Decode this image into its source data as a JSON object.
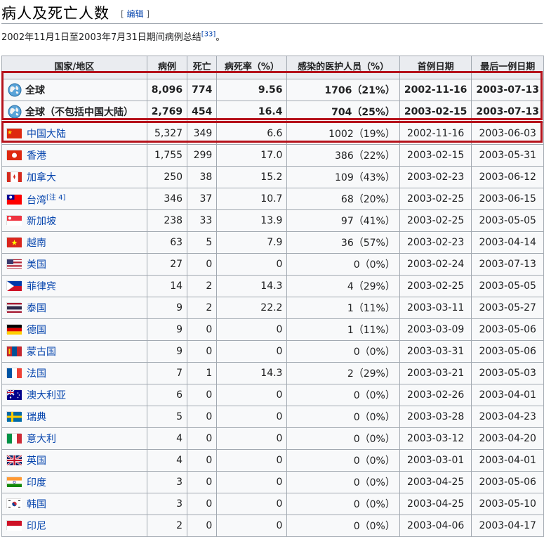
{
  "heading": {
    "title": "病人及死亡人数",
    "edit_open": "[ ",
    "edit_label": "编辑",
    "edit_close": " ]"
  },
  "summary": {
    "text": "2002年11月1日至2003年7月31日期间病例总结",
    "ref": "[33]",
    "tail": "。"
  },
  "columns": [
    "国家/地区",
    "病例",
    "死亡",
    "病死率（%）",
    "感染的医护人员（%）",
    "首例日期",
    "最后一例日期"
  ],
  "rows": [
    {
      "name": "全球",
      "cases": "8,096",
      "deaths": "774",
      "cfr": "9.56",
      "hcw": "1706（21%）",
      "first": "2002-11-16",
      "last": "2003-07-13",
      "flag": "globe",
      "bold": true
    },
    {
      "name": "全球（不包括中国大陆）",
      "cases": "2,769",
      "deaths": "454",
      "cfr": "16.4",
      "hcw": "704（25%）",
      "first": "2003-02-15",
      "last": "2003-07-13",
      "flag": "globe",
      "bold": true
    },
    {
      "name": "中国大陆",
      "cases": "5,327",
      "deaths": "349",
      "cfr": "6.6",
      "hcw": "1002（19%）",
      "first": "2002-11-16",
      "last": "2003-06-03",
      "flag": "china"
    },
    {
      "name": "香港",
      "cases": "1,755",
      "deaths": "299",
      "cfr": "17.0",
      "hcw": "386（22%）",
      "first": "2003-02-15",
      "last": "2003-05-31",
      "flag": "hongkong"
    },
    {
      "name": "加拿大",
      "cases": "250",
      "deaths": "38",
      "cfr": "15.2",
      "hcw": "109（43%）",
      "first": "2003-02-23",
      "last": "2003-06-12",
      "flag": "canada"
    },
    {
      "name": "台湾",
      "note": "[注 4]",
      "cases": "346",
      "deaths": "37",
      "cfr": "10.7",
      "hcw": "68（20%）",
      "first": "2003-02-25",
      "last": "2003-06-15",
      "flag": "taiwan"
    },
    {
      "name": "新加坡",
      "cases": "238",
      "deaths": "33",
      "cfr": "13.9",
      "hcw": "97（41%）",
      "first": "2003-02-25",
      "last": "2003-05-05",
      "flag": "singapore"
    },
    {
      "name": "越南",
      "cases": "63",
      "deaths": "5",
      "cfr": "7.9",
      "hcw": "36（57%）",
      "first": "2003-02-23",
      "last": "2003-04-14",
      "flag": "vietnam"
    },
    {
      "name": "美国",
      "cases": "27",
      "deaths": "0",
      "cfr": "0",
      "hcw": "0（0%）",
      "first": "2003-02-24",
      "last": "2003-07-13",
      "flag": "usa"
    },
    {
      "name": "菲律宾",
      "cases": "14",
      "deaths": "2",
      "cfr": "14.3",
      "hcw": "4（29%）",
      "first": "2003-02-25",
      "last": "2003-05-05",
      "flag": "philippines"
    },
    {
      "name": "泰国",
      "cases": "9",
      "deaths": "2",
      "cfr": "22.2",
      "hcw": "1（11%）",
      "first": "2003-03-11",
      "last": "2003-05-27",
      "flag": "thailand"
    },
    {
      "name": "德国",
      "cases": "9",
      "deaths": "0",
      "cfr": "0",
      "hcw": "1（11%）",
      "first": "2003-03-09",
      "last": "2003-05-06",
      "flag": "germany"
    },
    {
      "name": "蒙古国",
      "cases": "9",
      "deaths": "0",
      "cfr": "0",
      "hcw": "0（0%）",
      "first": "2003-03-31",
      "last": "2003-05-06",
      "flag": "mongolia"
    },
    {
      "name": "法国",
      "cases": "7",
      "deaths": "1",
      "cfr": "14.3",
      "hcw": "2（29%）",
      "first": "2003-03-21",
      "last": "2003-05-03",
      "flag": "france"
    },
    {
      "name": "澳大利亚",
      "cases": "6",
      "deaths": "0",
      "cfr": "0",
      "hcw": "0（0%）",
      "first": "2003-02-26",
      "last": "2003-04-01",
      "flag": "australia"
    },
    {
      "name": "瑞典",
      "cases": "5",
      "deaths": "0",
      "cfr": "0",
      "hcw": "0（0%）",
      "first": "2003-03-28",
      "last": "2003-04-23",
      "flag": "sweden"
    },
    {
      "name": "意大利",
      "cases": "4",
      "deaths": "0",
      "cfr": "0",
      "hcw": "0（0%）",
      "first": "2003-03-12",
      "last": "2003-04-20",
      "flag": "italy"
    },
    {
      "name": "英国",
      "cases": "4",
      "deaths": "0",
      "cfr": "0",
      "hcw": "0（0%）",
      "first": "2003-03-01",
      "last": "2003-04-01",
      "flag": "uk"
    },
    {
      "name": "印度",
      "cases": "3",
      "deaths": "0",
      "cfr": "0",
      "hcw": "0（0%）",
      "first": "2003-04-25",
      "last": "2003-05-06",
      "flag": "india"
    },
    {
      "name": "韩国",
      "cases": "3",
      "deaths": "0",
      "cfr": "0",
      "hcw": "0（0%）",
      "first": "2003-04-25",
      "last": "2003-05-10",
      "flag": "korea"
    },
    {
      "name": "印尼",
      "cases": "2",
      "deaths": "0",
      "cfr": "0",
      "hcw": "0（0%）",
      "first": "2003-04-06",
      "last": "2003-04-17",
      "flag": "indonesia"
    }
  ],
  "highlight_color": "#b5121b"
}
